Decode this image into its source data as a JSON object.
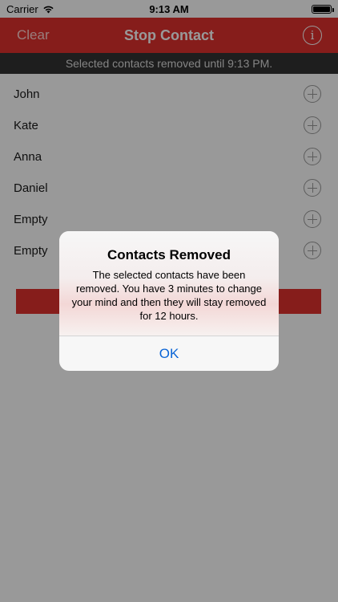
{
  "status_bar": {
    "carrier": "Carrier",
    "time": "9:13 AM",
    "wifi_icon": "wifi-icon",
    "battery_icon": "battery-icon"
  },
  "nav": {
    "left_button": "Clear",
    "title": "Stop Contact",
    "info_symbol": "i",
    "accent_color": "#e0312d"
  },
  "banner": {
    "text": "Selected contacts removed until 9:13 PM."
  },
  "contacts": [
    {
      "name": "John"
    },
    {
      "name": "Kate"
    },
    {
      "name": "Anna"
    },
    {
      "name": "Daniel"
    },
    {
      "name": "Empty"
    },
    {
      "name": "Empty"
    }
  ],
  "alert": {
    "title": "Contacts Removed",
    "message": "The selected contacts have been removed.  You have 3 minutes to change your mind and then they will stay removed for 12 hours.",
    "ok_label": "OK",
    "button_color": "#0a64d6"
  }
}
